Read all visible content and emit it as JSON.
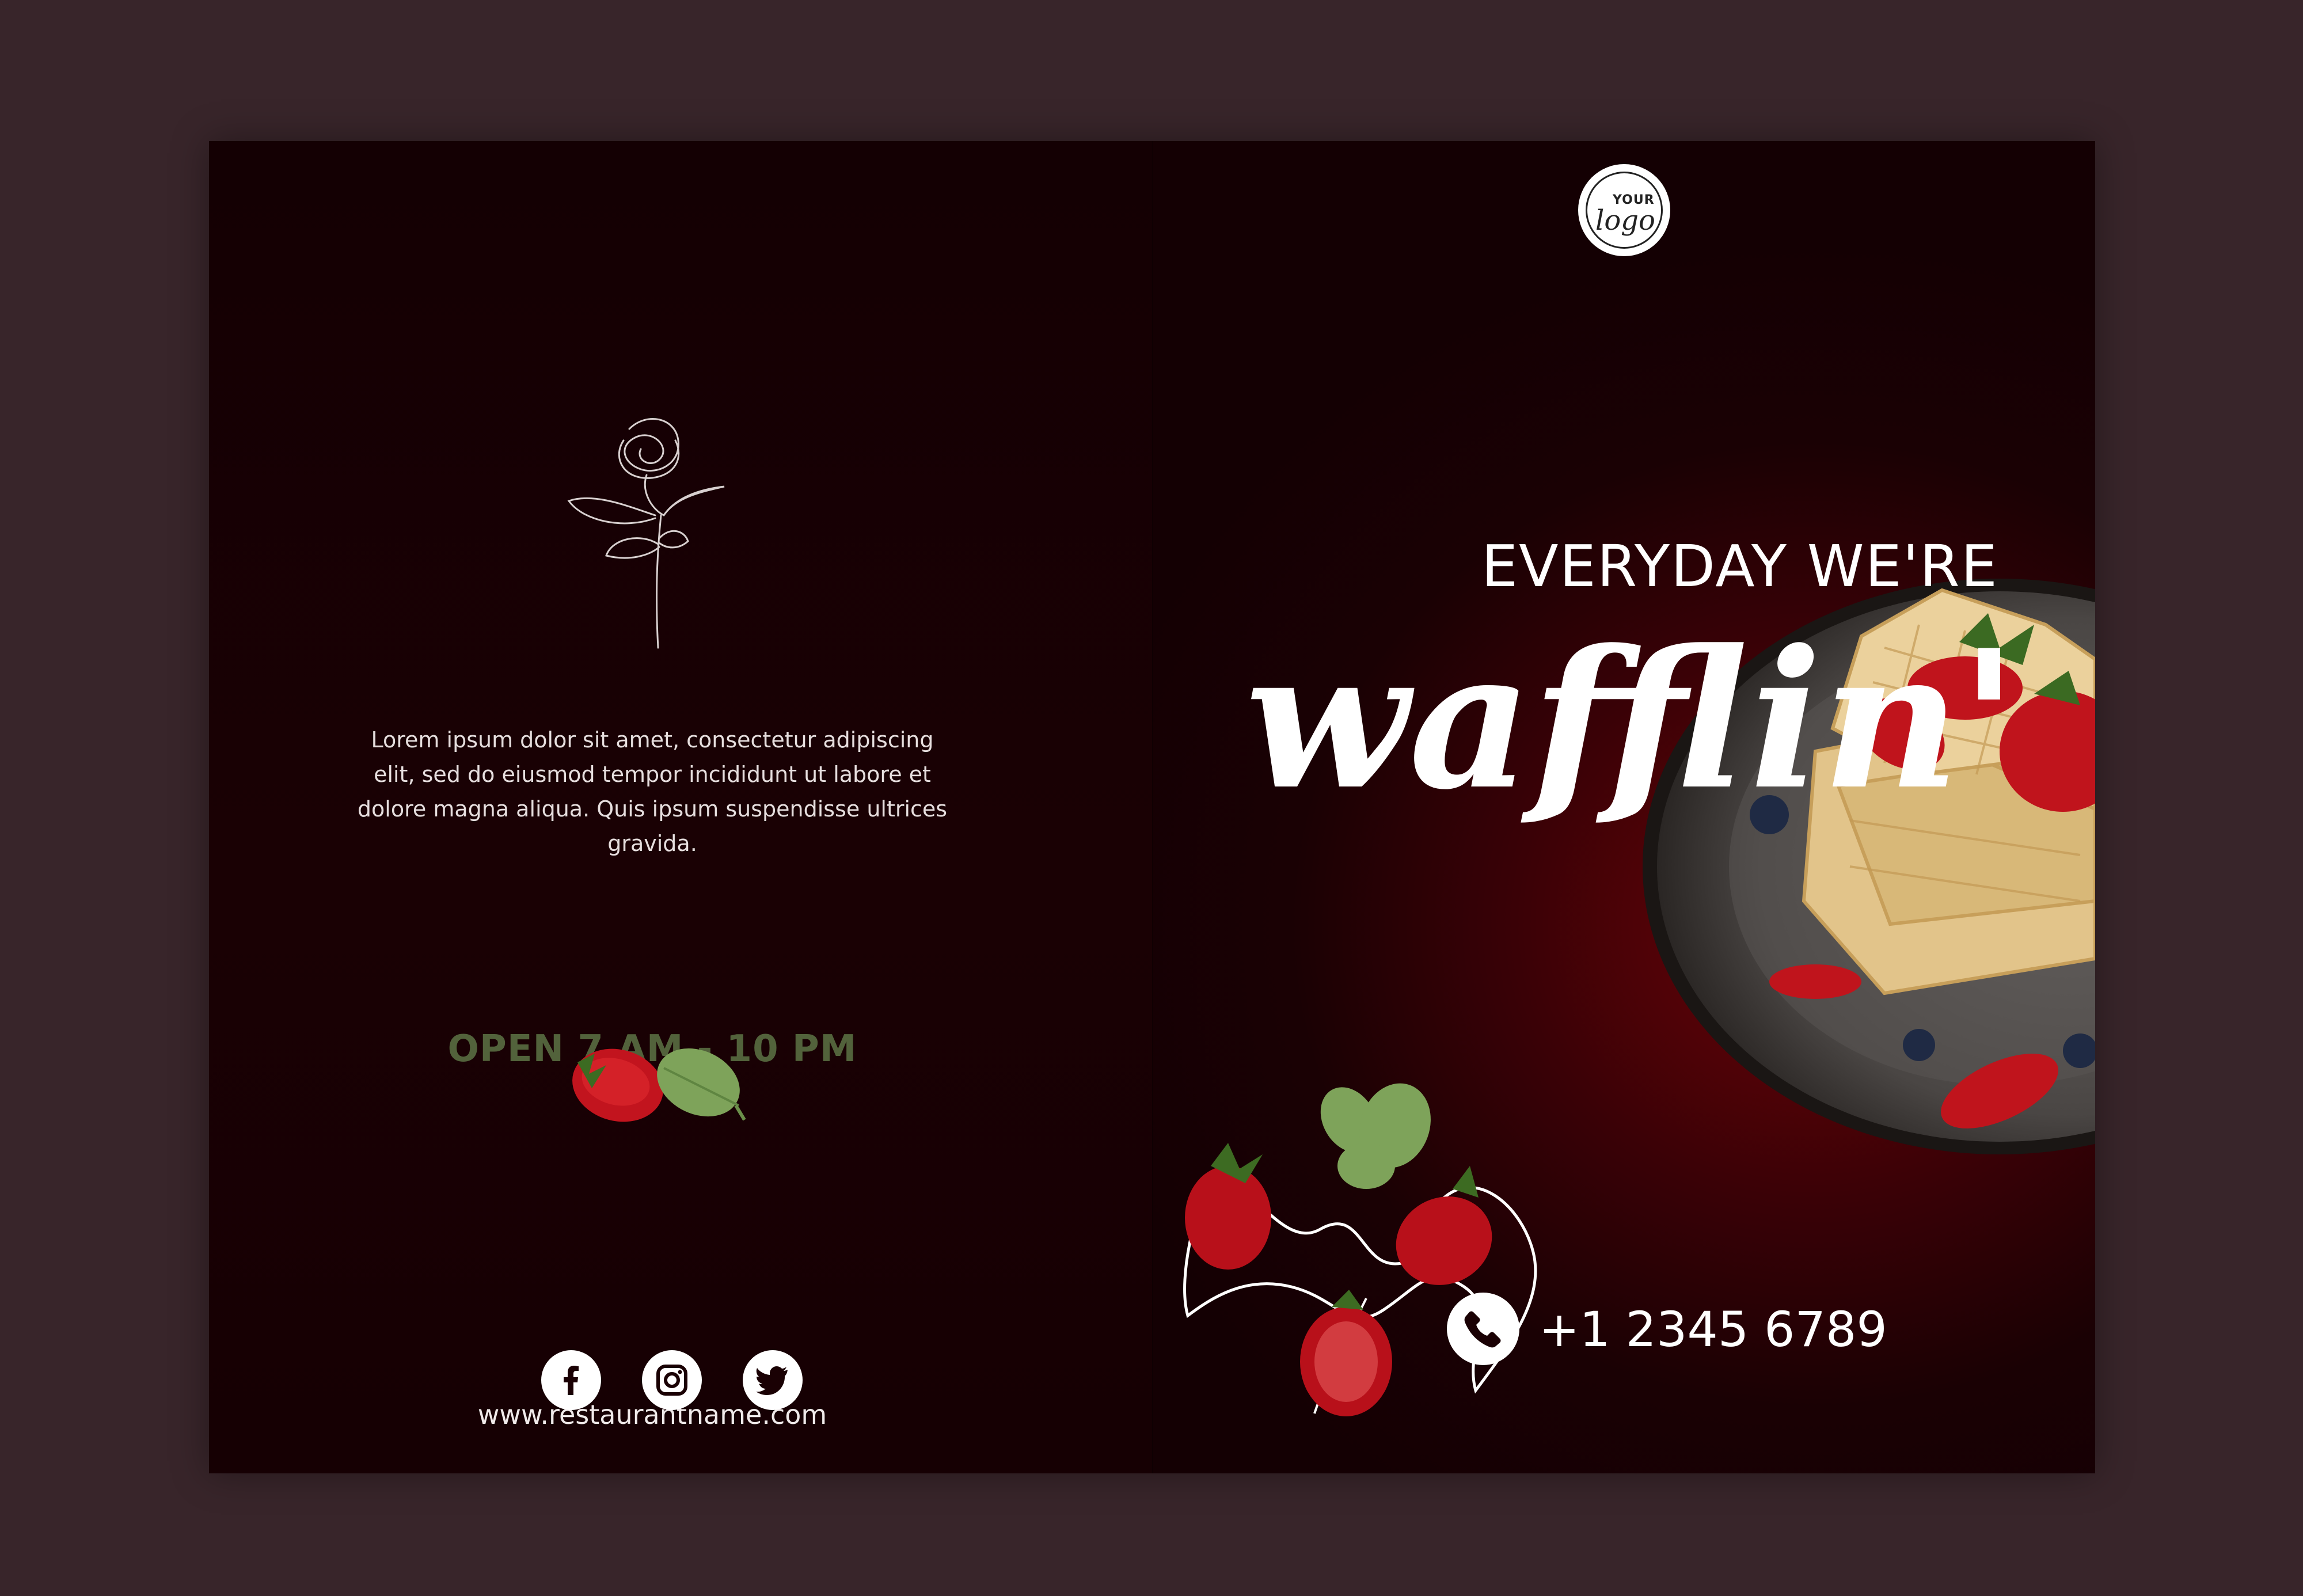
{
  "left_panel": {
    "body_text": "Lorem ipsum dolor sit amet, consectetur adipiscing elit, sed do eiusmod tempor incididunt ut labore et dolore magna aliqua. Quis ipsum suspendisse ultrices gravida.",
    "hours": "OPEN 7 AM - 10 PM",
    "website": "www.restaurantname.com",
    "social_icons": [
      "facebook-icon",
      "instagram-icon",
      "twitter-icon"
    ]
  },
  "right_panel": {
    "logo": {
      "line1": "YOUR",
      "line2": "logo"
    },
    "headline": "EVERYDAY WE'RE",
    "script_word": "wafflin'",
    "phone_icon": "phone-icon",
    "phone": "+1 2345 6789"
  },
  "colors": {
    "background": "#38252a",
    "sheet": "#160003",
    "accent_red": "#6b0308",
    "hours_green": "#52623b",
    "text": "#ffffff"
  }
}
